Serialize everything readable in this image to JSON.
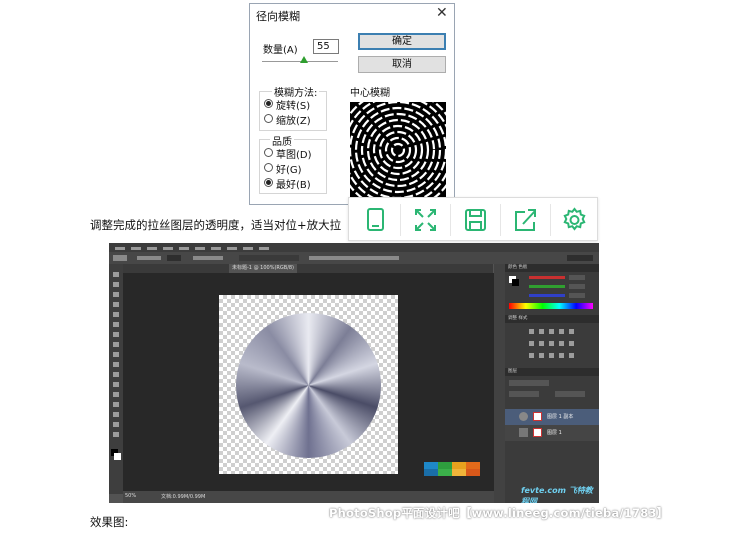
{
  "dialog": {
    "title": "径向模糊",
    "amount_label": "数量(A)",
    "amount_value": "55",
    "ok_label": "确定",
    "cancel_label": "取消",
    "method_group_label": "模糊方法:",
    "method_options": [
      "旋转(S)",
      "缩放(Z)"
    ],
    "quality_group_label": "品质",
    "quality_options": [
      "草图(D)",
      "好(G)",
      "最好(B)"
    ],
    "center_label": "中心模糊"
  },
  "caption": "调整完成的拉丝图层的透明度，适当对位+放大拉",
  "popup_toolbar": {
    "icons": [
      "phone-icon",
      "fullscreen-icon",
      "save-icon",
      "share-icon",
      "settings-icon"
    ],
    "icon_color": "#2bb673"
  },
  "photoshop": {
    "tab_label": "未标题-1 @ 100%(RGB/8)",
    "status_zoom": "50%",
    "status_doc": "文档:0.99M/0.99M",
    "layers_tab": "图层",
    "layer_names": [
      "图层 1 副本",
      "图层 1"
    ],
    "colors": {
      "bg": "#535353",
      "canvas": "#282828",
      "panel": "#3b3b3b"
    }
  },
  "watermark": "PhotoShop平面设计吧【www.lineeg.com/tieba/1783】",
  "effect_label": "效果图:",
  "site_logo": "fevte.com 飞特教程网"
}
